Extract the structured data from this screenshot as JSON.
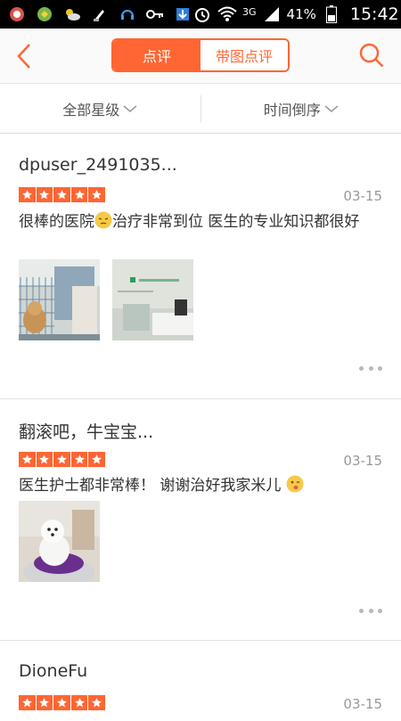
{
  "status_bar": {
    "battery": "41%",
    "network": "3G",
    "time": "15:42"
  },
  "header": {
    "tabs": [
      {
        "label": "点评",
        "active": true
      },
      {
        "label": "带图点评",
        "active": false
      }
    ],
    "accent_color": "#ff6633"
  },
  "filters": {
    "rating_label": "全部星级",
    "sort_label": "时间倒序"
  },
  "reviews": [
    {
      "username": "dpuser_2491035...",
      "stars": 5,
      "date": "03-15",
      "text_before_emoji": "很棒的医院",
      "emoji": "pensive-face",
      "text_after_emoji": "治疗非常到位 医生的专业知识都很好",
      "photo_count": 2
    },
    {
      "username": "翻滚吧，牛宝宝...",
      "stars": 5,
      "date": "03-15",
      "text_before_emoji": "医生护士都非常棒！ 谢谢治好我家米儿",
      "emoji": "winking-tongue-face",
      "text_after_emoji": "",
      "photo_count": 1
    },
    {
      "username": "DioneFu",
      "stars": 5,
      "date": "03-15"
    }
  ]
}
